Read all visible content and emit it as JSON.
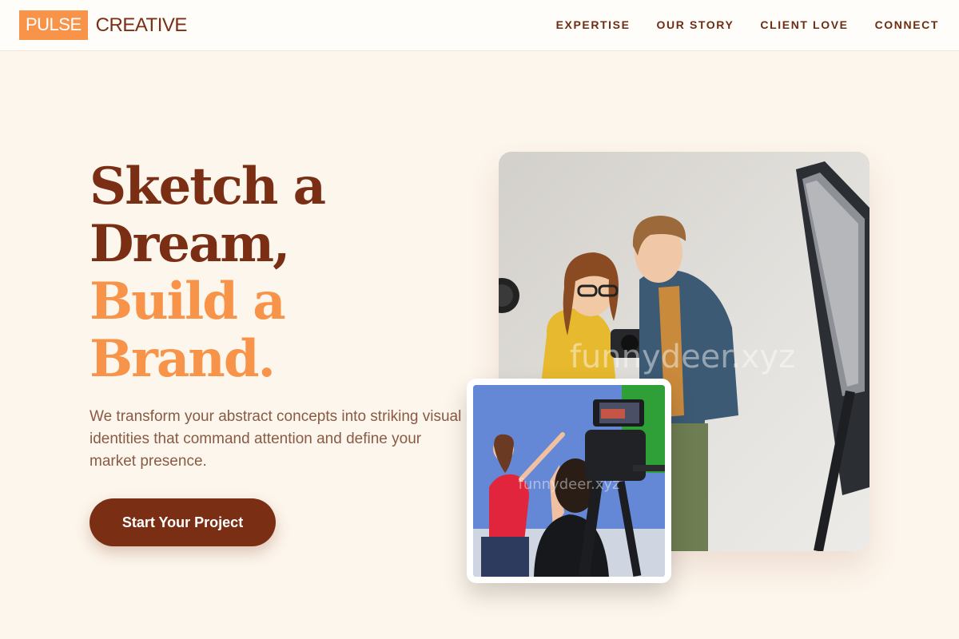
{
  "brand": {
    "box_text": "PULSE",
    "text": "CREATIVE"
  },
  "nav": {
    "items": [
      {
        "label": "EXPERTISE"
      },
      {
        "label": "OUR STORY"
      },
      {
        "label": "CLIENT LOVE"
      },
      {
        "label": "CONNECT"
      }
    ]
  },
  "hero": {
    "title_line1": "Sketch a",
    "title_line2": "Dream,",
    "title_line3": "Build a",
    "title_line4": "Brand.",
    "description": "We transform your abstract concepts into striking visual identities that command attention and define your market presence.",
    "cta_label": "Start Your Project"
  },
  "images": {
    "main_watermark": "funnydeer.xyz",
    "inset_watermark": "funnydeer.xyz"
  },
  "colors": {
    "background": "#fdf6ec",
    "primary": "#7a2f15",
    "accent": "#f7944a",
    "body_text": "#8a5a44"
  }
}
